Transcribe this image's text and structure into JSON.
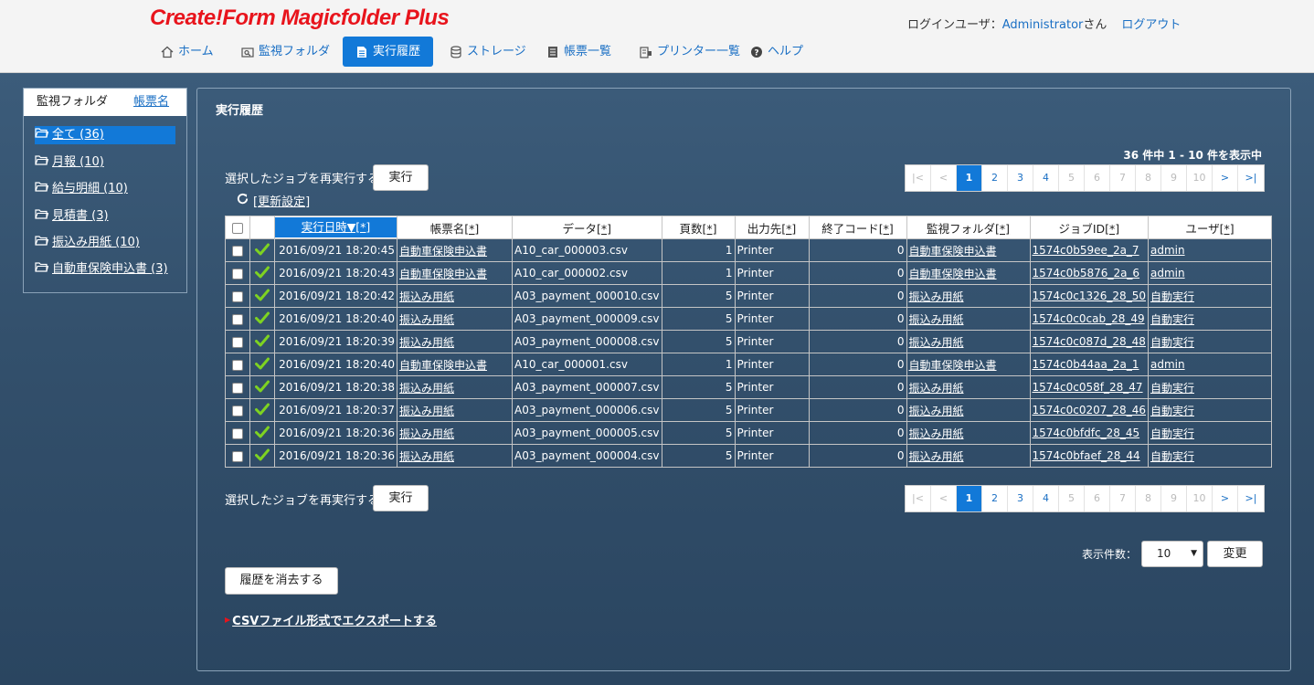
{
  "header": {
    "logo": "Create!Form Magicfolder Plus",
    "login_label": "ログインユーザ：",
    "username": "Administrator",
    "honorific": "さん",
    "logout": "ログアウト"
  },
  "nav": [
    {
      "label": "ホーム",
      "icon": "home-icon"
    },
    {
      "label": "監視フォルダ",
      "icon": "folder-search-icon"
    },
    {
      "label": "実行履歴",
      "icon": "document-icon",
      "active": true
    },
    {
      "label": "ストレージ",
      "icon": "database-icon"
    },
    {
      "label": "帳票一覧",
      "icon": "list-icon"
    },
    {
      "label": "プリンター一覧",
      "icon": "printer-icon"
    },
    {
      "label": "ヘルプ",
      "icon": "help-icon"
    }
  ],
  "sidebar": {
    "tab_folder": "監視フォルダ",
    "tab_form": "帳票名",
    "folders": [
      {
        "label": "全て (36)",
        "active": true
      },
      {
        "label": "月報 (10)"
      },
      {
        "label": "給与明細 (10)"
      },
      {
        "label": "見積書 (3)"
      },
      {
        "label": "振込み用紙 (10)"
      },
      {
        "label": "自動車保険申込書 (3)"
      }
    ]
  },
  "main": {
    "title": "実行履歴",
    "count_info": "36 件中 1 - 10 件を表示中",
    "rerun_label": "選択したジョブを再実行する",
    "rerun_button": "実行",
    "refresh_label": "[更新設定]",
    "pager": [
      "|<",
      "<",
      "1",
      "2",
      "3",
      "4",
      "5",
      "6",
      "7",
      "8",
      "9",
      "10",
      ">",
      ">|"
    ],
    "pager_current": "1",
    "columns": {
      "date": "実行日時▼[*]",
      "form": "帳票名",
      "data": "データ",
      "pages": "頁数",
      "output": "出力先",
      "exit": "終了コード",
      "folder": "監視フォルダ",
      "jobid": "ジョブID",
      "user": "ユーザ",
      "ast": "[*]"
    },
    "rows": [
      {
        "date": "2016/09/21 18:20:45",
        "form": "自動車保険申込書",
        "data": "A10_car_000003.csv",
        "pages": "1",
        "output": "Printer",
        "exit": "0",
        "folder": "自動車保険申込書",
        "jobid": "1574c0b59ee_2a_7",
        "user": "admin"
      },
      {
        "date": "2016/09/21 18:20:43",
        "form": "自動車保険申込書",
        "data": "A10_car_000002.csv",
        "pages": "1",
        "output": "Printer",
        "exit": "0",
        "folder": "自動車保険申込書",
        "jobid": "1574c0b5876_2a_6",
        "user": "admin"
      },
      {
        "date": "2016/09/21 18:20:42",
        "form": "振込み用紙",
        "data": "A03_payment_000010.csv",
        "pages": "5",
        "output": "Printer",
        "exit": "0",
        "folder": "振込み用紙",
        "jobid": "1574c0c1326_28_50",
        "user": "自動実行"
      },
      {
        "date": "2016/09/21 18:20:40",
        "form": "振込み用紙",
        "data": "A03_payment_000009.csv",
        "pages": "5",
        "output": "Printer",
        "exit": "0",
        "folder": "振込み用紙",
        "jobid": "1574c0c0cab_28_49",
        "user": "自動実行"
      },
      {
        "date": "2016/09/21 18:20:39",
        "form": "振込み用紙",
        "data": "A03_payment_000008.csv",
        "pages": "5",
        "output": "Printer",
        "exit": "0",
        "folder": "振込み用紙",
        "jobid": "1574c0c087d_28_48",
        "user": "自動実行"
      },
      {
        "date": "2016/09/21 18:20:40",
        "form": "自動車保険申込書",
        "data": "A10_car_000001.csv",
        "pages": "1",
        "output": "Printer",
        "exit": "0",
        "folder": "自動車保険申込書",
        "jobid": "1574c0b44aa_2a_1",
        "user": "admin"
      },
      {
        "date": "2016/09/21 18:20:38",
        "form": "振込み用紙",
        "data": "A03_payment_000007.csv",
        "pages": "5",
        "output": "Printer",
        "exit": "0",
        "folder": "振込み用紙",
        "jobid": "1574c0c058f_28_47",
        "user": "自動実行"
      },
      {
        "date": "2016/09/21 18:20:37",
        "form": "振込み用紙",
        "data": "A03_payment_000006.csv",
        "pages": "5",
        "output": "Printer",
        "exit": "0",
        "folder": "振込み用紙",
        "jobid": "1574c0c0207_28_46",
        "user": "自動実行"
      },
      {
        "date": "2016/09/21 18:20:36",
        "form": "振込み用紙",
        "data": "A03_payment_000005.csv",
        "pages": "5",
        "output": "Printer",
        "exit": "0",
        "folder": "振込み用紙",
        "jobid": "1574c0bfdfc_28_45",
        "user": "自動実行"
      },
      {
        "date": "2016/09/21 18:20:36",
        "form": "振込み用紙",
        "data": "A03_payment_000004.csv",
        "pages": "5",
        "output": "Printer",
        "exit": "0",
        "folder": "振込み用紙",
        "jobid": "1574c0bfaef_28_44",
        "user": "自動実行"
      }
    ],
    "page_size_label": "表示件数：",
    "page_size_value": "10",
    "change_button": "変更",
    "clear_button": "履歴を消去する",
    "export_link": "CSVファイル形式でエクスポートする"
  },
  "colors": {
    "accent": "#1279d8",
    "logo_red": "#e8141c",
    "success_green": "#7ed321"
  }
}
